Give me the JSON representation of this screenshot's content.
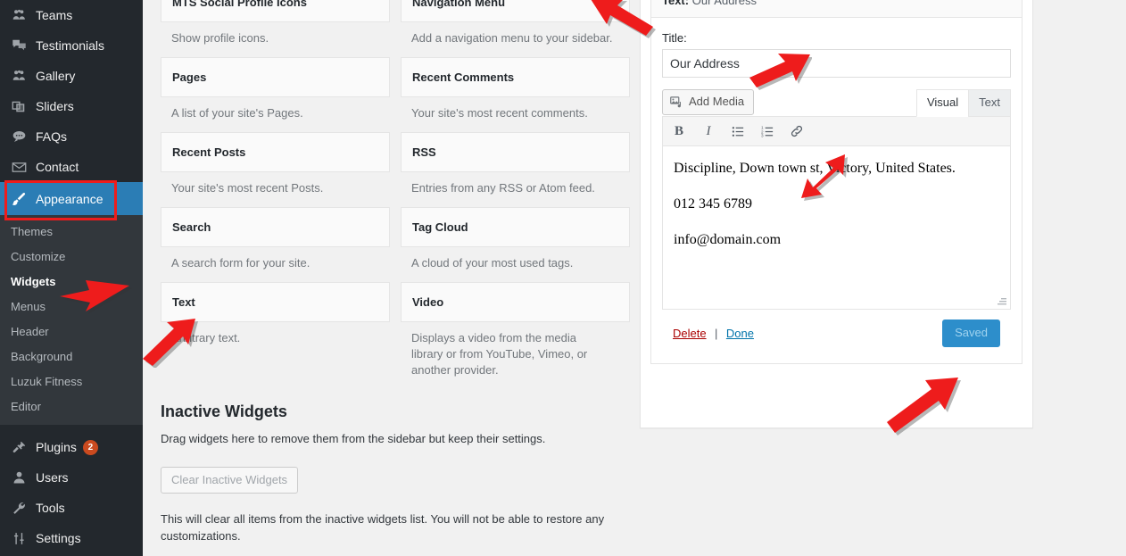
{
  "sidebar": {
    "items": [
      {
        "label": "Teams",
        "icon": "users-group-icon"
      },
      {
        "label": "Testimonials",
        "icon": "speech-bubbles-icon"
      },
      {
        "label": "Gallery",
        "icon": "users-group-icon"
      },
      {
        "label": "Sliders",
        "icon": "slides-icon"
      },
      {
        "label": "FAQs",
        "icon": "comment-bubble-icon"
      },
      {
        "label": "Contact",
        "icon": "envelope-icon"
      },
      {
        "label": "Appearance",
        "icon": "paintbrush-icon"
      }
    ],
    "submenu": [
      {
        "label": "Themes",
        "active": false
      },
      {
        "label": "Customize",
        "active": false
      },
      {
        "label": "Widgets",
        "active": true
      },
      {
        "label": "Menus",
        "active": false
      },
      {
        "label": "Header",
        "active": false
      },
      {
        "label": "Background",
        "active": false
      },
      {
        "label": "Luzuk Fitness",
        "active": false
      },
      {
        "label": "Editor",
        "active": false
      }
    ],
    "bottom_items": [
      {
        "label": "Plugins",
        "icon": "plug-icon",
        "count": "2"
      },
      {
        "label": "Users",
        "icon": "user-icon",
        "count": ""
      },
      {
        "label": "Tools",
        "icon": "wrench-icon",
        "count": ""
      },
      {
        "label": "Settings",
        "icon": "sliders-icon",
        "count": ""
      }
    ]
  },
  "available_widgets": {
    "left_column": [
      {
        "name": "MTS Social Profile Icons",
        "description": "Show profile icons."
      },
      {
        "name": "Pages",
        "description": "A list of your site's Pages."
      },
      {
        "name": "Recent Posts",
        "description": "Your site's most recent Posts."
      },
      {
        "name": "Search",
        "description": "A search form for your site."
      },
      {
        "name": "Text",
        "description": "Arbitrary text."
      }
    ],
    "right_column": [
      {
        "name": "Navigation Menu",
        "description": "Add a navigation menu to your sidebar."
      },
      {
        "name": "Recent Comments",
        "description": "Your site's most recent comments."
      },
      {
        "name": "RSS",
        "description": "Entries from any RSS or Atom feed."
      },
      {
        "name": "Tag Cloud",
        "description": "A cloud of your most used tags."
      },
      {
        "name": "Video",
        "description": "Displays a video from the media library or from YouTube, Vimeo, or another provider."
      }
    ]
  },
  "inactive_widgets": {
    "title": "Inactive Widgets",
    "subtitle": "Drag widgets here to remove them from the sidebar but keep their settings.",
    "clear_button": "Clear Inactive Widgets",
    "note": "This will clear all items from the inactive widgets list. You will not be able to restore any customizations."
  },
  "text_widget": {
    "header_prefix": "Text:",
    "header_title": "Our Address",
    "title_label": "Title:",
    "title_value": "Our Address",
    "add_media_label": "Add Media",
    "tabs": [
      {
        "label": "Visual",
        "active": true
      },
      {
        "label": "Text",
        "active": false
      }
    ],
    "toolbar": [
      {
        "icon": "bold-icon",
        "glyph": "B"
      },
      {
        "icon": "italic-icon",
        "glyph": "I"
      },
      {
        "icon": "bulleted-list-icon",
        "glyph": ""
      },
      {
        "icon": "numbered-list-icon",
        "glyph": ""
      },
      {
        "icon": "link-icon",
        "glyph": ""
      }
    ],
    "content_lines": [
      "Discipline, Down town st, Victory, United States.",
      "012 345 6789",
      "info@domain.com"
    ],
    "delete_label": "Delete",
    "separator": "|",
    "done_label": "Done",
    "save_label": "Saved"
  },
  "colors": {
    "admin_bg": "#23282d",
    "submenu_bg": "#32373c",
    "accent_blue": "#2b7db5",
    "save_blue": "#2d8ecb",
    "highlight_red": "#ee1c1c",
    "badge_orange": "#ca4a1f",
    "page_bg": "#f1f1f1"
  }
}
